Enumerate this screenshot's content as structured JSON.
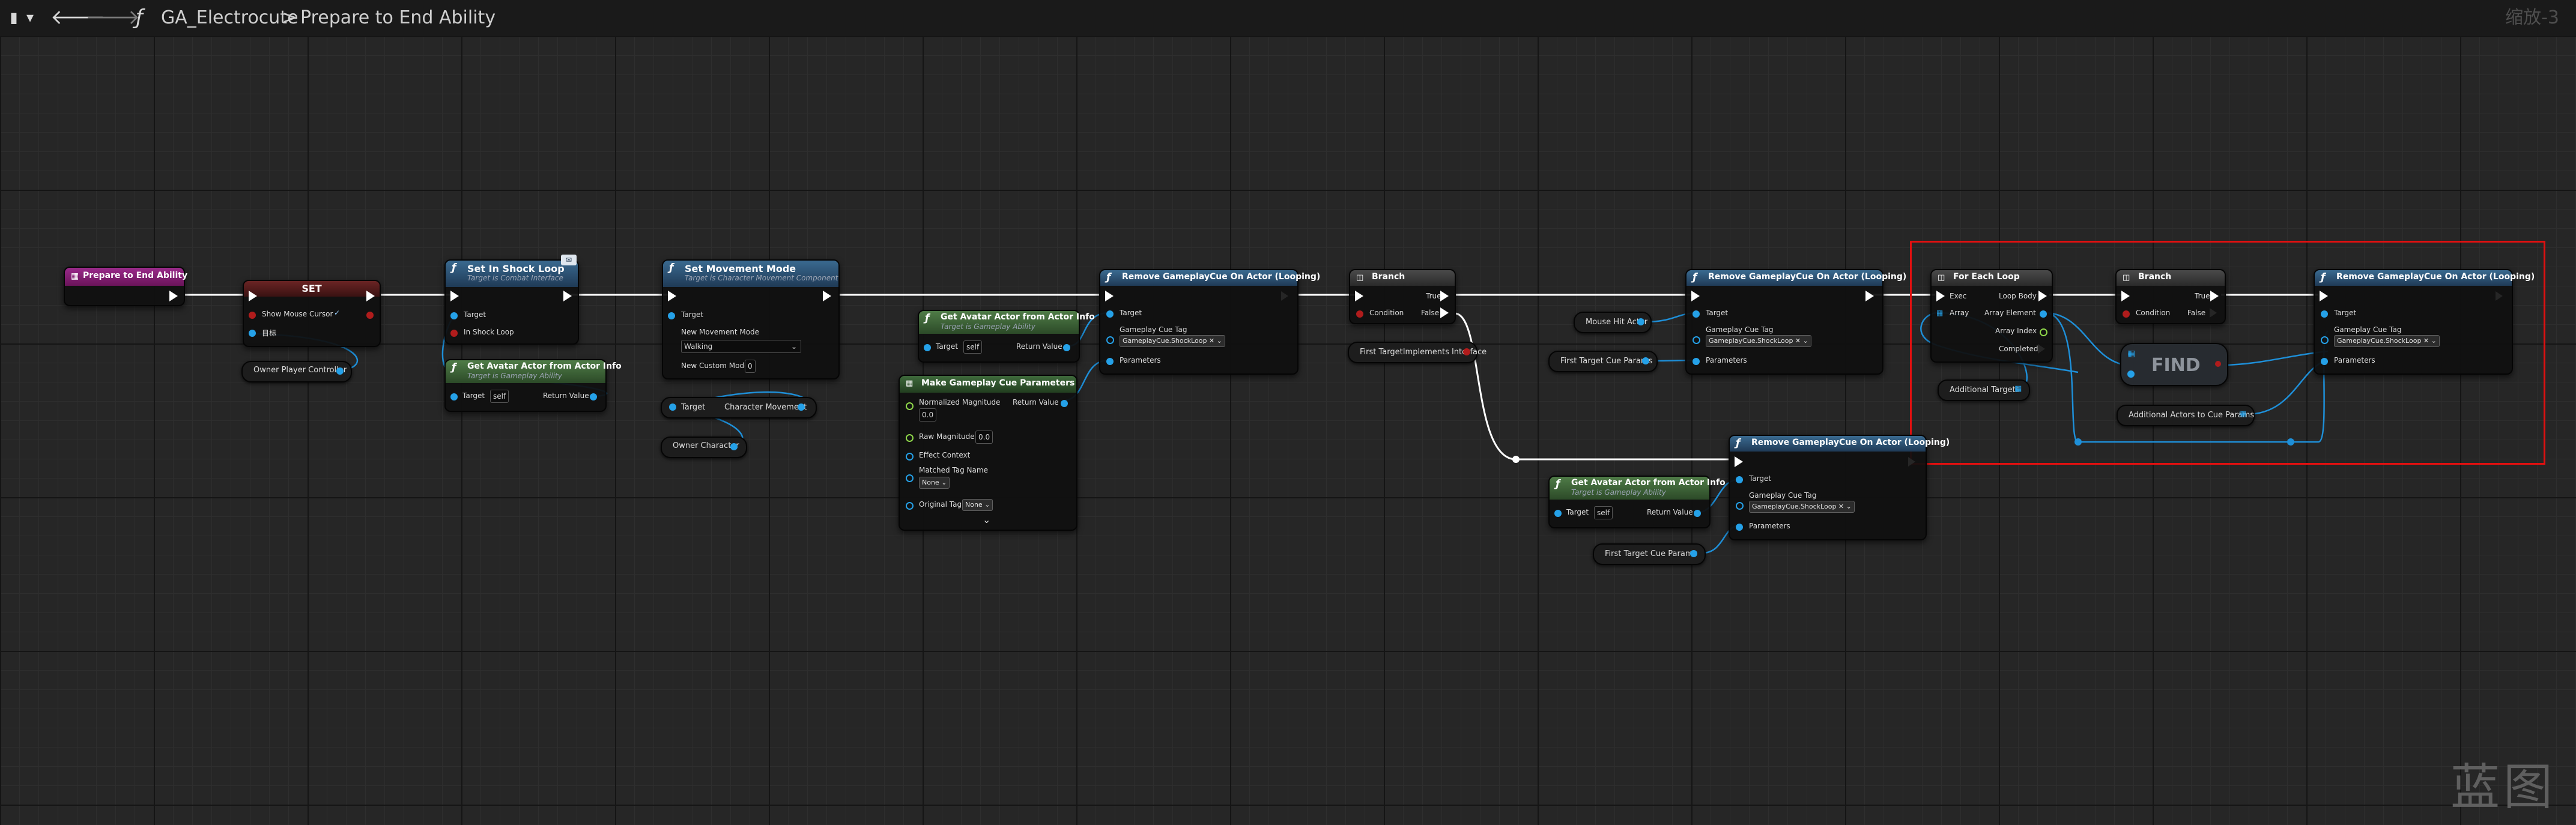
{
  "toolbar": {
    "bookmark_glyph": "▮",
    "dropdown_glyph": "▾",
    "back_glyph": "🡐",
    "forward_glyph": "🡒",
    "function_glyph": "ƒ",
    "breadcrumb_parent": "GA_Electrocute",
    "breadcrumb_separator": ">",
    "breadcrumb_current": "Prepare to End Ability",
    "zoom_label": "缩放-3"
  },
  "colors": {
    "event_header": "#7a1a6c",
    "set_header": "#4a1a1a",
    "function_header": "#294a66",
    "pure_header": "#3b5e36",
    "struct_header": "#355a34",
    "branch_header": "#3a3a3a",
    "exec_wire": "#ffffff",
    "object_wire": "#1e8fd8",
    "comment_border": "#e01010"
  },
  "nodes": {
    "event": {
      "title": "Prepare to End Ability"
    },
    "set": {
      "title": "SET",
      "show_mouse_cursor": "Show Mouse Cursor",
      "target": "目标"
    },
    "owner_pc": {
      "label": "Owner Player Controller"
    },
    "set_shock": {
      "title": "Set In Shock Loop",
      "subtitle": "Target is Combat Interface",
      "target": "Target",
      "in_shock": "In Shock Loop"
    },
    "avatar1": {
      "title": "Get Avatar Actor from Actor Info",
      "subtitle": "Target is Gameplay Ability",
      "target": "Target",
      "self": "self",
      "ret": "Return Value"
    },
    "set_move": {
      "title": "Set Movement Mode",
      "subtitle": "Target is Character Movement Component",
      "target": "Target",
      "new_mode": "New Movement Mode",
      "mode_value": "Walking",
      "custom": "New Custom Mode",
      "custom_value": "0"
    },
    "char_move": {
      "target": "Target",
      "label": "Character Movement"
    },
    "owner_char": {
      "label": "Owner Character"
    },
    "avatar2": {
      "title": "Get Avatar Actor from Actor Info",
      "subtitle": "Target is Gameplay Ability",
      "target": "Target",
      "self": "self",
      "ret": "Return Value"
    },
    "make_params": {
      "title": "Make Gameplay Cue Parameters",
      "norm_mag": "Normalized Magnitude",
      "norm_val": "0.0",
      "raw_mag": "Raw Magnitude",
      "raw_val": "0.0",
      "effect": "Effect Context",
      "matched": "Matched Tag Name",
      "none1": "None",
      "orig": "Original Tag",
      "none2": "None",
      "ret": "Return Value",
      "expand": "⌄"
    },
    "remove1": {
      "title": "Remove GameplayCue On Actor (Looping)",
      "target": "Target",
      "cue_tag": "Gameplay Cue Tag",
      "cue_value": "GameplayCue.ShockLoop",
      "params": "Parameters"
    },
    "branch1": {
      "title": "Branch",
      "cond": "Condition",
      "true": "True",
      "false": "False"
    },
    "first_target_iface": {
      "label": "First TargetImplements Interface"
    },
    "mouse_hit": {
      "label": "Mouse Hit Actor"
    },
    "first_params1": {
      "label": "First Target Cue Params"
    },
    "remove2": {
      "title": "Remove GameplayCue On Actor (Looping)",
      "target": "Target",
      "cue_tag": "Gameplay Cue Tag",
      "cue_value": "GameplayCue.ShockLoop",
      "params": "Parameters"
    },
    "avatar3": {
      "title": "Get Avatar Actor from Actor Info",
      "subtitle": "Target is Gameplay Ability",
      "target": "Target",
      "self": "self",
      "ret": "Return Value"
    },
    "first_params2": {
      "label": "First Target Cue Params"
    },
    "remove3": {
      "title": "Remove GameplayCue On Actor (Looping)",
      "target": "Target",
      "cue_tag": "Gameplay Cue Tag",
      "cue_value": "GameplayCue.ShockLoop",
      "params": "Parameters"
    },
    "foreach": {
      "title": "For Each Loop",
      "exec": "Exec",
      "loop_body": "Loop Body",
      "array": "Array",
      "element": "Array Element",
      "index": "Array Index",
      "completed": "Completed"
    },
    "additional_targets": {
      "label": "Additional Targets"
    },
    "branch2": {
      "title": "Branch",
      "cond": "Condition",
      "true": "True",
      "false": "False"
    },
    "find": {
      "label": "FIND"
    },
    "additional_params": {
      "label": "Additional Actors to Cue Params"
    },
    "remove4": {
      "title": "Remove GameplayCue On Actor (Looping)",
      "target": "Target",
      "cue_tag": "Gameplay Cue Tag",
      "cue_value": "GameplayCue.ShockLoop",
      "params": "Parameters"
    }
  },
  "watermark": "蓝图"
}
